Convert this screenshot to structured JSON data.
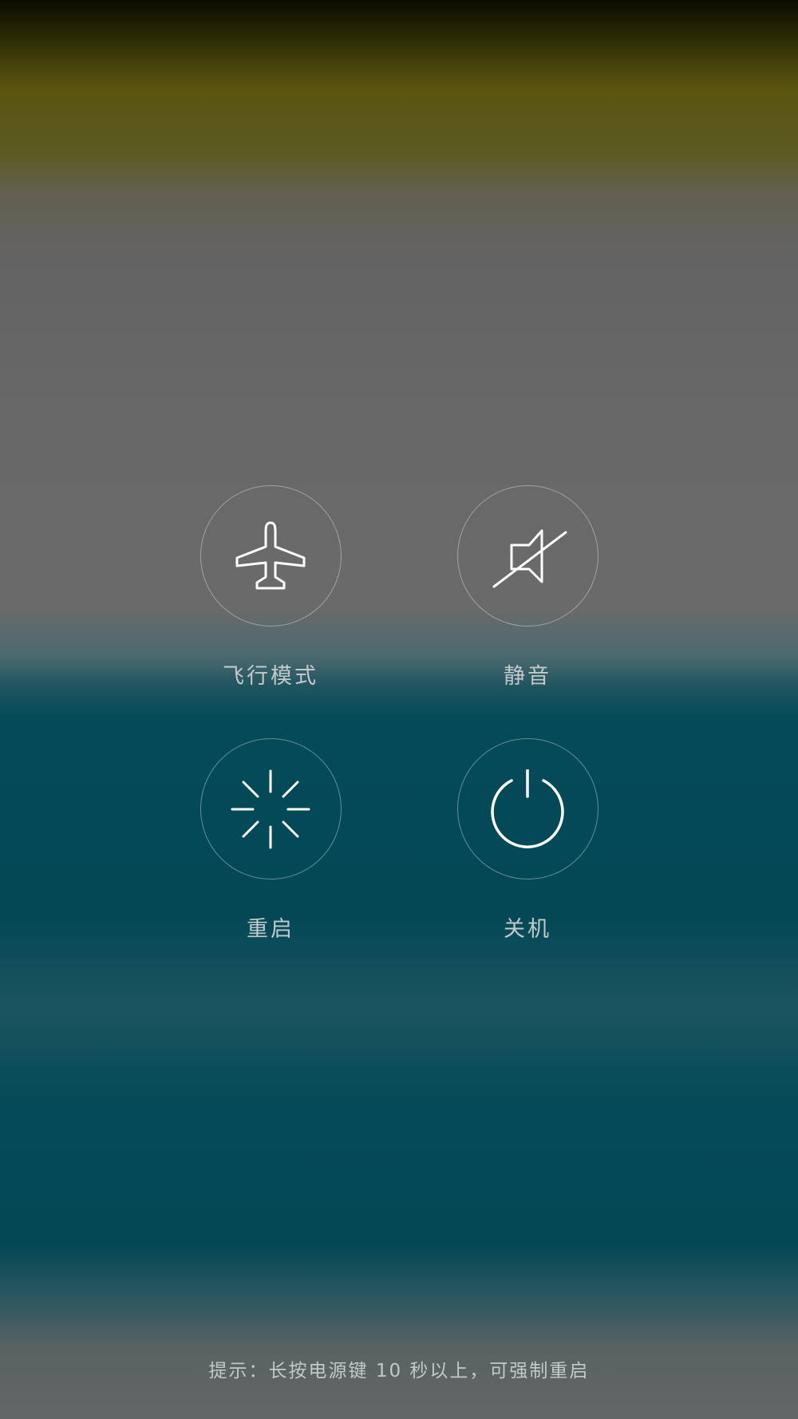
{
  "actions": [
    {
      "id": "airplane",
      "label": "飞行模式",
      "icon": "airplane-icon"
    },
    {
      "id": "mute",
      "label": "静音",
      "icon": "speaker-muted-icon"
    },
    {
      "id": "restart",
      "label": "重启",
      "icon": "restart-spinner-icon"
    },
    {
      "id": "power",
      "label": "关机",
      "icon": "power-icon"
    }
  ],
  "hint": "提示：长按电源键 10 秒以上，可强制重启",
  "colors": {
    "label_text": "#c3c9cb",
    "icon_stroke": "#ffffff",
    "circle_border": "rgba(255,255,255,0.38)",
    "teal_background": "#044856"
  }
}
